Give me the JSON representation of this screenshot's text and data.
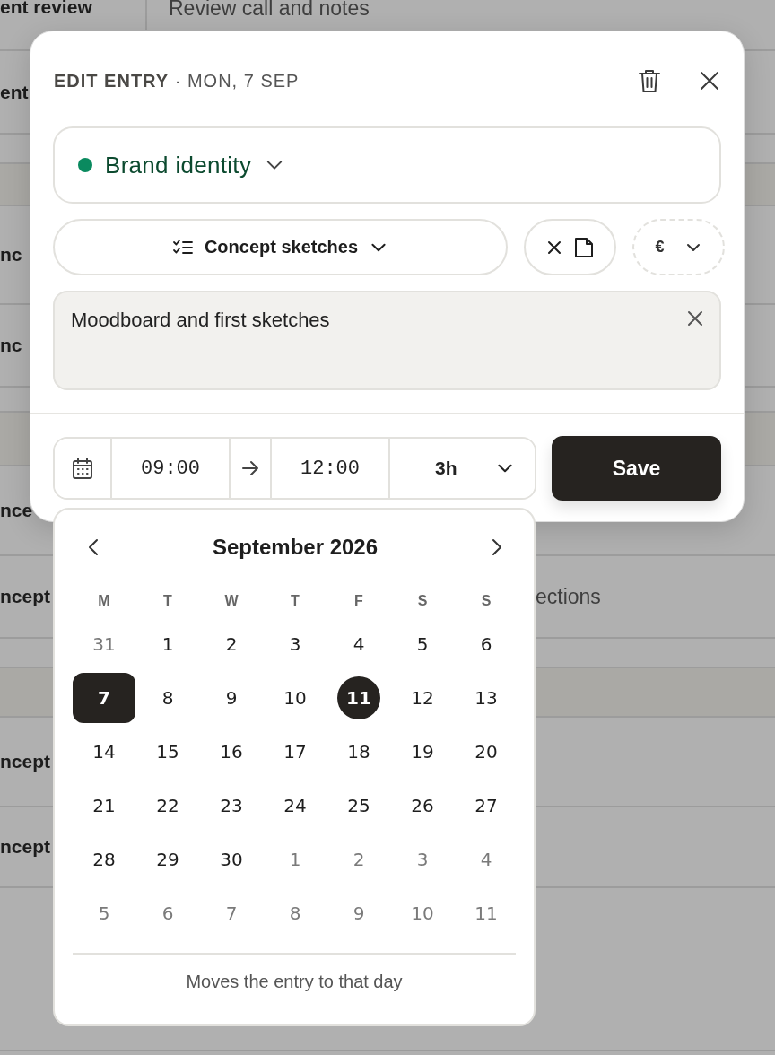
{
  "background": {
    "rows": [
      {
        "kind": "item",
        "cells": [
          "ent review",
          "Review call and notes"
        ]
      },
      {
        "kind": "item",
        "cells": [
          "ent"
        ]
      },
      {
        "kind": "blank"
      },
      {
        "kind": "band"
      },
      {
        "kind": "item",
        "cells": [
          "nc"
        ]
      },
      {
        "kind": "item",
        "cells": [
          "nc"
        ]
      },
      {
        "kind": "blank"
      },
      {
        "kind": "band"
      },
      {
        "kind": "item",
        "cells": [
          "nce"
        ]
      },
      {
        "kind": "item",
        "cells": [
          "ncept",
          "ections"
        ]
      },
      {
        "kind": "blank"
      },
      {
        "kind": "band"
      },
      {
        "kind": "item",
        "cells": [
          "ncept"
        ]
      },
      {
        "kind": "item",
        "cells": [
          "ncept"
        ]
      },
      {
        "kind": "blank"
      }
    ]
  },
  "dialog": {
    "title": "EDIT ENTRY",
    "date": "· MON, 7 SEP",
    "project": {
      "name": "Brand identity",
      "color": "#0a8a5f"
    },
    "task": {
      "name": "Concept sketches"
    },
    "billing": {
      "symbol": "€"
    },
    "note": {
      "value": "Moodboard and first sketches"
    },
    "time": {
      "start": "09:00",
      "end": "12:00",
      "duration": "3h"
    },
    "save": "Save"
  },
  "calendar": {
    "month": "September 2026",
    "weekdays": [
      "M",
      "T",
      "W",
      "T",
      "F",
      "S",
      "S"
    ],
    "weeks": [
      [
        {
          "day": "31",
          "outside": true,
          "selected": false,
          "today": false
        },
        {
          "day": "1",
          "outside": false,
          "selected": false,
          "today": false
        },
        {
          "day": "2",
          "outside": false,
          "selected": false,
          "today": false
        },
        {
          "day": "3",
          "outside": false,
          "selected": false,
          "today": false
        },
        {
          "day": "4",
          "outside": false,
          "selected": false,
          "today": false
        },
        {
          "day": "5",
          "outside": false,
          "selected": false,
          "today": false
        },
        {
          "day": "6",
          "outside": false,
          "selected": false,
          "today": false
        }
      ],
      [
        {
          "day": "7",
          "outside": false,
          "selected": true,
          "today": false
        },
        {
          "day": "8",
          "outside": false,
          "selected": false,
          "today": false
        },
        {
          "day": "9",
          "outside": false,
          "selected": false,
          "today": false
        },
        {
          "day": "10",
          "outside": false,
          "selected": false,
          "today": false
        },
        {
          "day": "11",
          "outside": false,
          "selected": false,
          "today": true
        },
        {
          "day": "12",
          "outside": false,
          "selected": false,
          "today": false
        },
        {
          "day": "13",
          "outside": false,
          "selected": false,
          "today": false
        }
      ],
      [
        {
          "day": "14",
          "outside": false,
          "selected": false,
          "today": false
        },
        {
          "day": "15",
          "outside": false,
          "selected": false,
          "today": false
        },
        {
          "day": "16",
          "outside": false,
          "selected": false,
          "today": false
        },
        {
          "day": "17",
          "outside": false,
          "selected": false,
          "today": false
        },
        {
          "day": "18",
          "outside": false,
          "selected": false,
          "today": false
        },
        {
          "day": "19",
          "outside": false,
          "selected": false,
          "today": false
        },
        {
          "day": "20",
          "outside": false,
          "selected": false,
          "today": false
        }
      ],
      [
        {
          "day": "21",
          "outside": false,
          "selected": false,
          "today": false
        },
        {
          "day": "22",
          "outside": false,
          "selected": false,
          "today": false
        },
        {
          "day": "23",
          "outside": false,
          "selected": false,
          "today": false
        },
        {
          "day": "24",
          "outside": false,
          "selected": false,
          "today": false
        },
        {
          "day": "25",
          "outside": false,
          "selected": false,
          "today": false
        },
        {
          "day": "26",
          "outside": false,
          "selected": false,
          "today": false
        },
        {
          "day": "27",
          "outside": false,
          "selected": false,
          "today": false
        }
      ],
      [
        {
          "day": "28",
          "outside": false,
          "selected": false,
          "today": false
        },
        {
          "day": "29",
          "outside": false,
          "selected": false,
          "today": false
        },
        {
          "day": "30",
          "outside": false,
          "selected": false,
          "today": false
        },
        {
          "day": "1",
          "outside": true,
          "selected": false,
          "today": false
        },
        {
          "day": "2",
          "outside": true,
          "selected": false,
          "today": false
        },
        {
          "day": "3",
          "outside": true,
          "selected": false,
          "today": false
        },
        {
          "day": "4",
          "outside": true,
          "selected": false,
          "today": false
        }
      ],
      [
        {
          "day": "5",
          "outside": true,
          "selected": false,
          "today": false
        },
        {
          "day": "6",
          "outside": true,
          "selected": false,
          "today": false
        },
        {
          "day": "7",
          "outside": true,
          "selected": false,
          "today": false
        },
        {
          "day": "8",
          "outside": true,
          "selected": false,
          "today": false
        },
        {
          "day": "9",
          "outside": true,
          "selected": false,
          "today": false
        },
        {
          "day": "10",
          "outside": true,
          "selected": false,
          "today": false
        },
        {
          "day": "11",
          "outside": true,
          "selected": false,
          "today": false
        }
      ]
    ],
    "hint": "Moves the entry to that day"
  }
}
